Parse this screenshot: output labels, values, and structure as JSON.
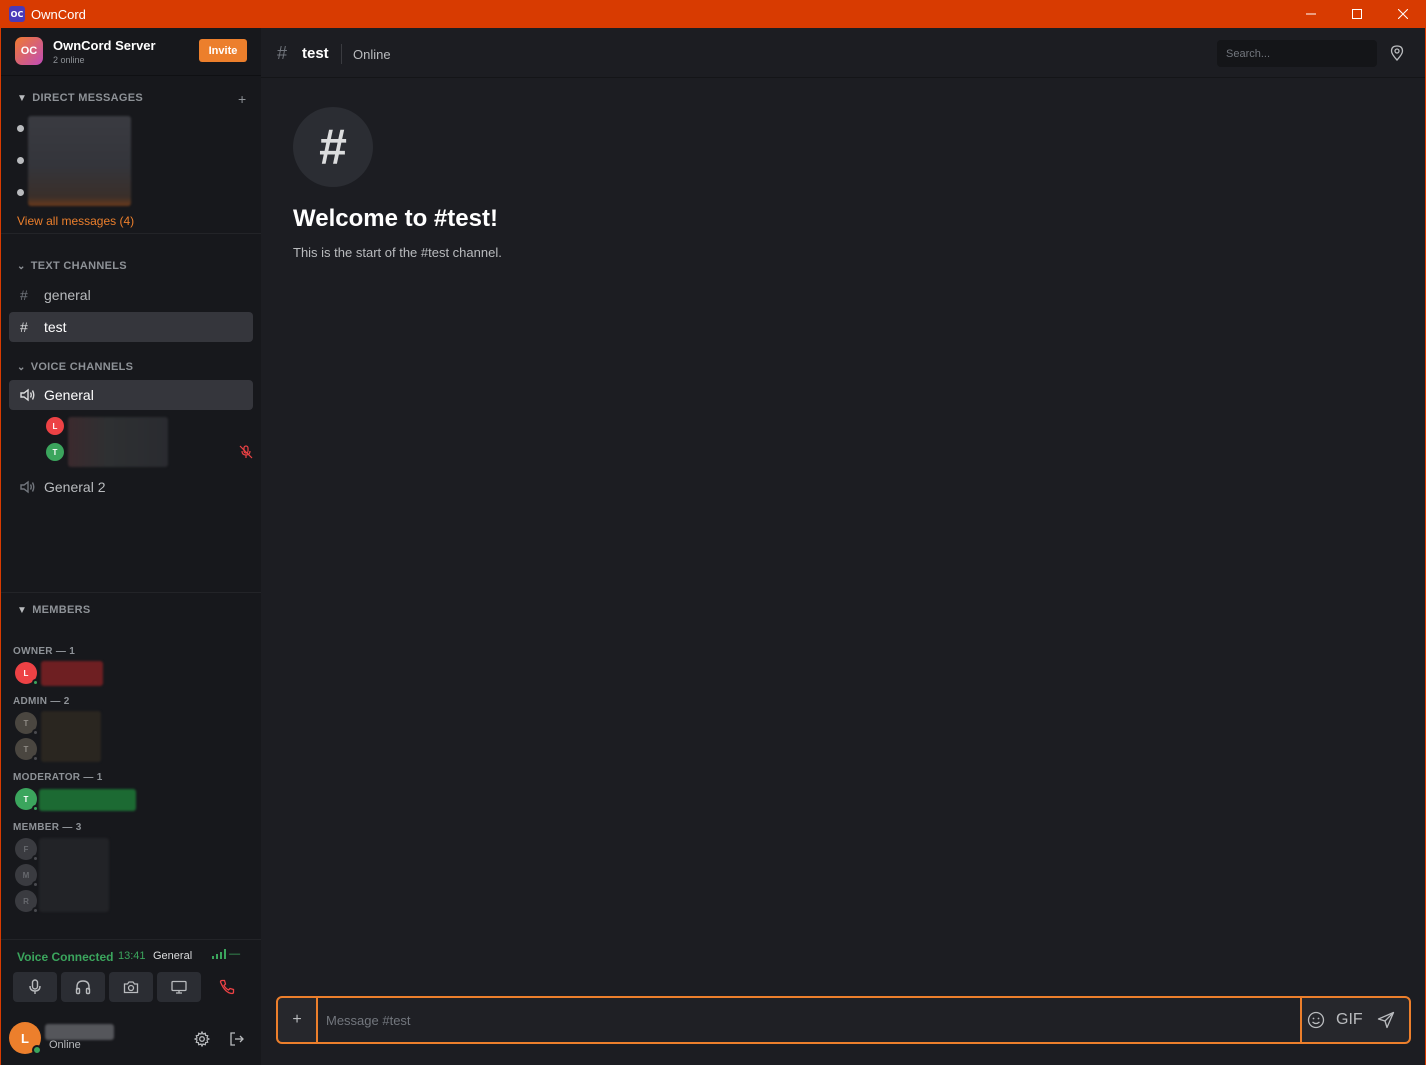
{
  "window": {
    "logo": "OC",
    "title": "OwnCord"
  },
  "server": {
    "icon_text": "OC",
    "name": "OwnCord Server",
    "online": "2 online",
    "invite_label": "Invite"
  },
  "direct_messages": {
    "header": "DIRECT MESSAGES",
    "add_label": "+",
    "view_all": "View all messages (4)"
  },
  "text_channels": {
    "header": "TEXT CHANNELS",
    "items": [
      {
        "name": "general",
        "active": false
      },
      {
        "name": "test",
        "active": true
      }
    ]
  },
  "voice_channels": {
    "header": "VOICE CHANNELS",
    "items": [
      {
        "name": "General",
        "active": true
      },
      {
        "name": "General 2",
        "active": false
      }
    ],
    "participants": [
      {
        "initial": "L",
        "color": "#ed4245"
      },
      {
        "initial": "T",
        "color": "#3ba55d"
      }
    ]
  },
  "members": {
    "header": "MEMBERS",
    "groups": [
      {
        "label": "OWNER — 1",
        "members": [
          {
            "initial": "L",
            "color": "#ed4245",
            "online": true
          }
        ]
      },
      {
        "label": "ADMIN — 2",
        "members": [
          {
            "initial": "T",
            "color": "#5a5045",
            "online": false
          },
          {
            "initial": "T",
            "color": "#5a5045",
            "online": false
          }
        ]
      },
      {
        "label": "MODERATOR — 1",
        "members": [
          {
            "initial": "T",
            "color": "#3ba55d",
            "online": true
          }
        ]
      },
      {
        "label": "MEMBER — 3",
        "members": [
          {
            "initial": "F",
            "color": "#4a4b50",
            "online": false
          },
          {
            "initial": "M",
            "color": "#4a4b50",
            "online": false
          },
          {
            "initial": "R",
            "color": "#4a4b50",
            "online": false
          }
        ]
      }
    ]
  },
  "voice_panel": {
    "status": "Voice Connected",
    "time": "13:41",
    "channel": "General",
    "signal": "—"
  },
  "user": {
    "initial": "L",
    "status": "Online"
  },
  "header": {
    "channel": "test",
    "status": "Online",
    "search_placeholder": "Search..."
  },
  "welcome": {
    "title": "Welcome to #test!",
    "subtitle": "This is the start of the #test channel."
  },
  "composer": {
    "plus": "+",
    "placeholder": "Message #test",
    "gif": "GIF"
  },
  "colors": {
    "accent": "#ec7f2c",
    "titlebar": "#d83b01",
    "online": "#3ba55d",
    "danger": "#ed4245"
  }
}
